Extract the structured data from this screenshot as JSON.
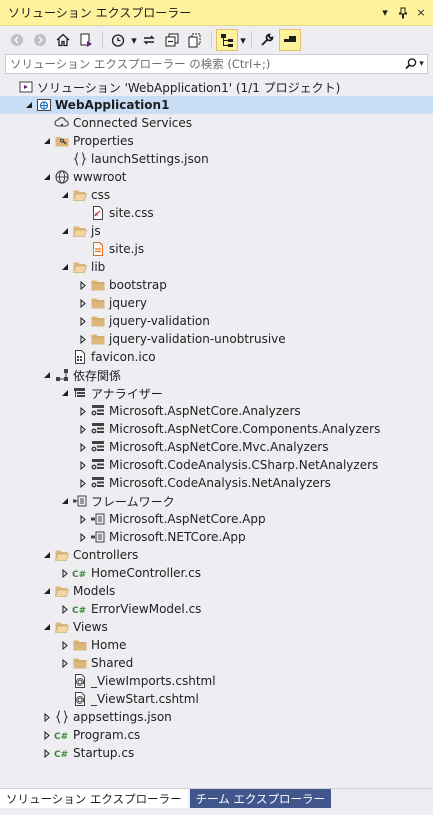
{
  "window": {
    "title": "ソリューション エクスプローラー",
    "controls": [
      "▾",
      "ᛕ",
      "×"
    ]
  },
  "toolbar": {
    "icons": [
      "back-icon",
      "forward-icon",
      "home-icon",
      "switch-views-icon",
      "pending-changes-icon",
      "sync-icon",
      "collapse-all-icon",
      "show-all-files-icon",
      "toggle-view-icon",
      "properties-icon",
      "preview-icon"
    ]
  },
  "search": {
    "placeholder": "ソリューション エクスプローラー の検索 (Ctrl+;)"
  },
  "tree": [
    {
      "label": "ソリューション 'WebApplication1' (1/1 プロジェクト)",
      "depth": 0,
      "exp": "none",
      "icon": "solution-icon"
    },
    {
      "label": "WebApplication1",
      "depth": 1,
      "exp": "open",
      "icon": "web-project-icon",
      "bold": true,
      "selected": true
    },
    {
      "label": "Connected Services",
      "depth": 2,
      "exp": "none",
      "icon": "connected-services-icon"
    },
    {
      "label": "Properties",
      "depth": 2,
      "exp": "open",
      "icon": "properties-folder-icon"
    },
    {
      "label": "launchSettings.json",
      "depth": 3,
      "exp": "none",
      "icon": "json-file-icon"
    },
    {
      "label": "wwwroot",
      "depth": 2,
      "exp": "open",
      "icon": "globe-icon"
    },
    {
      "label": "css",
      "depth": 3,
      "exp": "open",
      "icon": "folder-open-icon"
    },
    {
      "label": "site.css",
      "depth": 4,
      "exp": "none",
      "icon": "css-file-icon"
    },
    {
      "label": "js",
      "depth": 3,
      "exp": "open",
      "icon": "folder-open-icon"
    },
    {
      "label": "site.js",
      "depth": 4,
      "exp": "none",
      "icon": "js-file-icon"
    },
    {
      "label": "lib",
      "depth": 3,
      "exp": "open",
      "icon": "folder-open-icon"
    },
    {
      "label": "bootstrap",
      "depth": 4,
      "exp": "closed",
      "icon": "folder-icon"
    },
    {
      "label": "jquery",
      "depth": 4,
      "exp": "closed",
      "icon": "folder-icon"
    },
    {
      "label": "jquery-validation",
      "depth": 4,
      "exp": "closed",
      "icon": "folder-icon"
    },
    {
      "label": "jquery-validation-unobtrusive",
      "depth": 4,
      "exp": "closed",
      "icon": "folder-icon"
    },
    {
      "label": "favicon.ico",
      "depth": 3,
      "exp": "none",
      "icon": "ico-file-icon"
    },
    {
      "label": "依存関係",
      "depth": 2,
      "exp": "open",
      "icon": "dependencies-icon"
    },
    {
      "label": "アナライザー",
      "depth": 3,
      "exp": "open",
      "icon": "analyzer-icon"
    },
    {
      "label": "Microsoft.AspNetCore.Analyzers",
      "depth": 4,
      "exp": "closed",
      "icon": "analyzer-package-icon"
    },
    {
      "label": "Microsoft.AspNetCore.Components.Analyzers",
      "depth": 4,
      "exp": "closed",
      "icon": "analyzer-package-icon"
    },
    {
      "label": "Microsoft.AspNetCore.Mvc.Analyzers",
      "depth": 4,
      "exp": "closed",
      "icon": "analyzer-package-icon"
    },
    {
      "label": "Microsoft.CodeAnalysis.CSharp.NetAnalyzers",
      "depth": 4,
      "exp": "closed",
      "icon": "analyzer-package-icon"
    },
    {
      "label": "Microsoft.CodeAnalysis.NetAnalyzers",
      "depth": 4,
      "exp": "closed",
      "icon": "analyzer-package-icon"
    },
    {
      "label": "フレームワーク",
      "depth": 3,
      "exp": "open",
      "icon": "framework-icon"
    },
    {
      "label": "Microsoft.AspNetCore.App",
      "depth": 4,
      "exp": "closed",
      "icon": "framework-package-icon"
    },
    {
      "label": "Microsoft.NETCore.App",
      "depth": 4,
      "exp": "closed",
      "icon": "framework-package-icon"
    },
    {
      "label": "Controllers",
      "depth": 2,
      "exp": "open",
      "icon": "folder-open-icon"
    },
    {
      "label": "HomeController.cs",
      "depth": 3,
      "exp": "closed",
      "icon": "csharp-file-icon"
    },
    {
      "label": "Models",
      "depth": 2,
      "exp": "open",
      "icon": "folder-open-icon"
    },
    {
      "label": "ErrorViewModel.cs",
      "depth": 3,
      "exp": "closed",
      "icon": "csharp-file-icon"
    },
    {
      "label": "Views",
      "depth": 2,
      "exp": "open",
      "icon": "folder-open-icon"
    },
    {
      "label": "Home",
      "depth": 3,
      "exp": "closed",
      "icon": "folder-icon"
    },
    {
      "label": "Shared",
      "depth": 3,
      "exp": "closed",
      "icon": "folder-icon"
    },
    {
      "label": "_ViewImports.cshtml",
      "depth": 3,
      "exp": "none",
      "icon": "razor-file-icon"
    },
    {
      "label": "_ViewStart.cshtml",
      "depth": 3,
      "exp": "none",
      "icon": "razor-file-icon"
    },
    {
      "label": "appsettings.json",
      "depth": 2,
      "exp": "closed",
      "icon": "json-file-icon"
    },
    {
      "label": "Program.cs",
      "depth": 2,
      "exp": "closed",
      "icon": "csharp-file-icon"
    },
    {
      "label": "Startup.cs",
      "depth": 2,
      "exp": "closed",
      "icon": "csharp-file-icon"
    }
  ],
  "tabs": [
    {
      "label": "ソリューション エクスプローラー",
      "active": true
    },
    {
      "label": "チーム エクスプローラー",
      "active": false
    }
  ],
  "colors": {
    "title_bg": "#fff29d",
    "selection": "#c9def5",
    "inactive_tab": "#40568d",
    "csharp_green": "#388a34",
    "folder": "#dcb67a"
  }
}
